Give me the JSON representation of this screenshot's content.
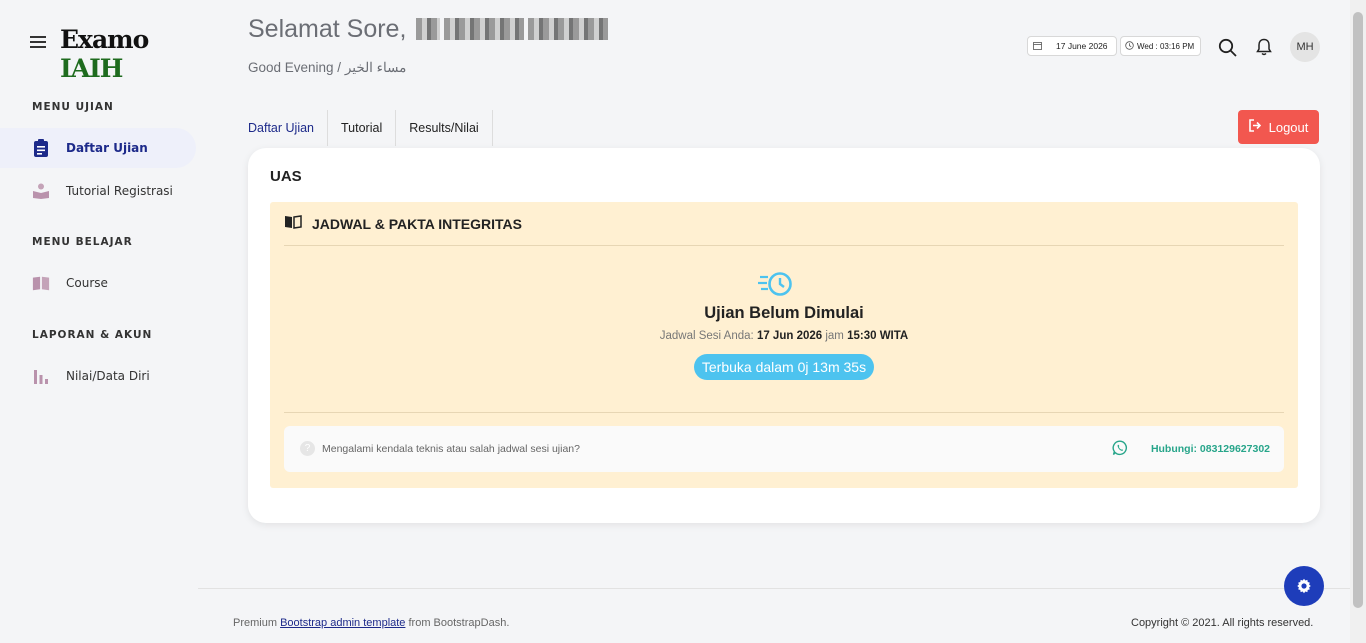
{
  "app": {
    "logo_part1": "Examo",
    "logo_part2": "IAIH"
  },
  "sidebar": {
    "categories": [
      "MENU UJIAN",
      "MENU BELAJAR",
      "LAPORAN & AKUN"
    ],
    "items": [
      {
        "label": "Daftar Ujian",
        "icon": "clipboard-icon",
        "active": true
      },
      {
        "label": "Tutorial Registrasi",
        "icon": "reader-icon",
        "active": false
      },
      {
        "label": "Course",
        "icon": "book-icon",
        "active": false
      },
      {
        "label": "Nilai/Data Diri",
        "icon": "bar-chart-icon",
        "active": false
      }
    ]
  },
  "header": {
    "greeting": "Selamat Sore,",
    "subgreeting": "Good Evening / مساء الخير",
    "date": "17 June 2026",
    "time": "Wed : 03:16 PM",
    "avatar_initials": "MH"
  },
  "tabs": [
    "Daftar Ujian",
    "Tutorial",
    "Results/Nilai"
  ],
  "logout_label": "Logout",
  "card": {
    "title": "UAS",
    "panel_title": "JADWAL & PAKTA INTEGRITAS",
    "status_title": "Ujian Belum Dimulai",
    "schedule_prefix": "Jadwal Sesi Anda:",
    "schedule_date": "17 Jun 2026",
    "schedule_mid": "jam",
    "schedule_time": "15:30 WITA",
    "countdown": "Terbuka dalam 0j 13m 35s",
    "help_text": "Mengalami kendala teknis atau salah jadwal sesi ujian?",
    "help_contact": "Hubungi: 083129627302"
  },
  "footer": {
    "prefix": "Premium",
    "link": "Bootstrap admin template",
    "suffix": "from BootstrapDash.",
    "copyright": "Copyright © 2021. All rights reserved."
  },
  "colors": {
    "accent": "#1d2a8a",
    "logout": "#f2574f",
    "panel_bg": "#fff0d2",
    "countdown": "#4dc3ef",
    "whatsapp": "#27a58a",
    "fab": "#1e3dba"
  }
}
